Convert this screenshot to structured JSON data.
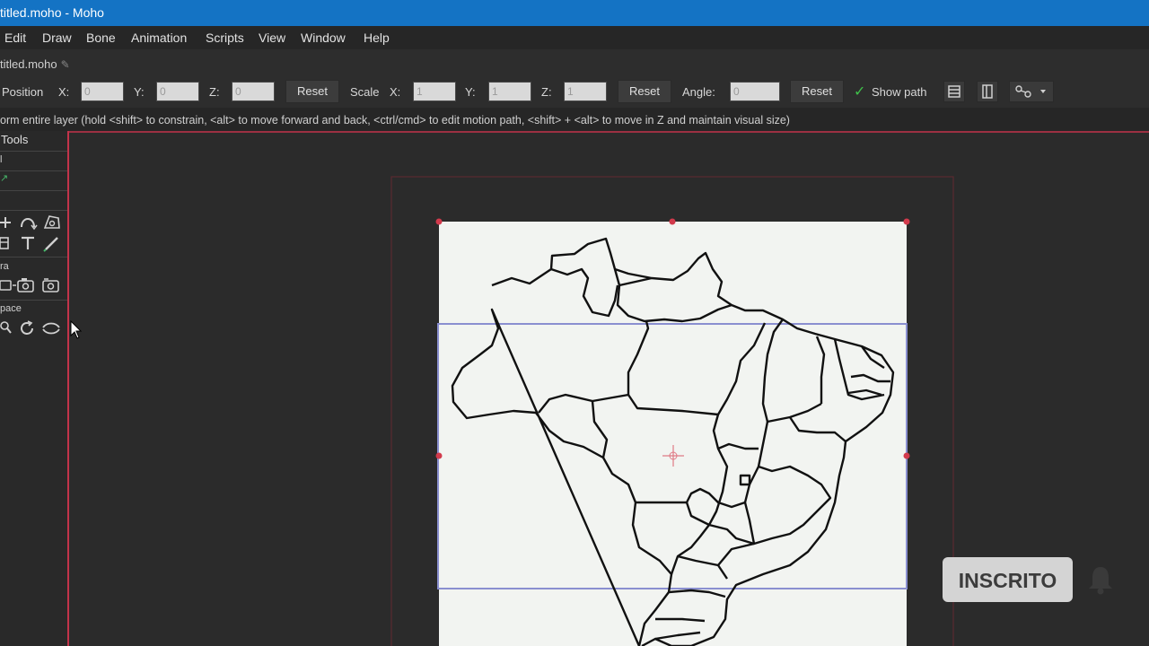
{
  "window": {
    "title": "titled.moho - Moho",
    "titlebar_color": "#1473c4"
  },
  "menu": {
    "items": [
      "Edit",
      "Draw",
      "Bone",
      "Animation",
      "Scripts",
      "View",
      "Window",
      "Help"
    ]
  },
  "document_tab": {
    "label": "titled.moho",
    "icon": "pencil-icon"
  },
  "toolbar": {
    "position_label": "Position",
    "x_label": "X:",
    "y_label": "Y:",
    "z_label": "Z:",
    "position_x": "0",
    "position_y": "0",
    "position_z": "0",
    "reset_label": "Reset",
    "scale_label": "Scale",
    "scale_x": "1",
    "scale_y": "1",
    "scale_z": "1",
    "angle_label": "Angle:",
    "angle_value": "0",
    "show_path_label": "Show path",
    "show_path_checked": true,
    "icons": [
      "layer-icon",
      "frame-icon",
      "bone-options-icon"
    ]
  },
  "status": {
    "hint": "orm entire layer (hold <shift> to constrain, <alt> to move forward and back, <ctrl/cmd> to edit motion path, <shift> + <alt> to move in Z and maintain visual size)"
  },
  "tools_panel": {
    "title": "Tools",
    "sections": [
      "l",
      "ra",
      "pace"
    ],
    "icons": [
      "translate-icon",
      "curve-icon",
      "warp-icon",
      "bookmark-icon",
      "text-icon",
      "pen-icon",
      "camera-pan-icon",
      "camera-icon",
      "camera-roll-icon",
      "zoom-icon",
      "rotate-icon",
      "orbit-icon"
    ]
  },
  "canvas": {
    "content": "map-of-brazil-states",
    "selection_color": "#8a8fd0",
    "frame_color": "#cc3344"
  },
  "overlay": {
    "subscribe_label": "INSCRITO",
    "bell_icon": "bell-icon"
  }
}
